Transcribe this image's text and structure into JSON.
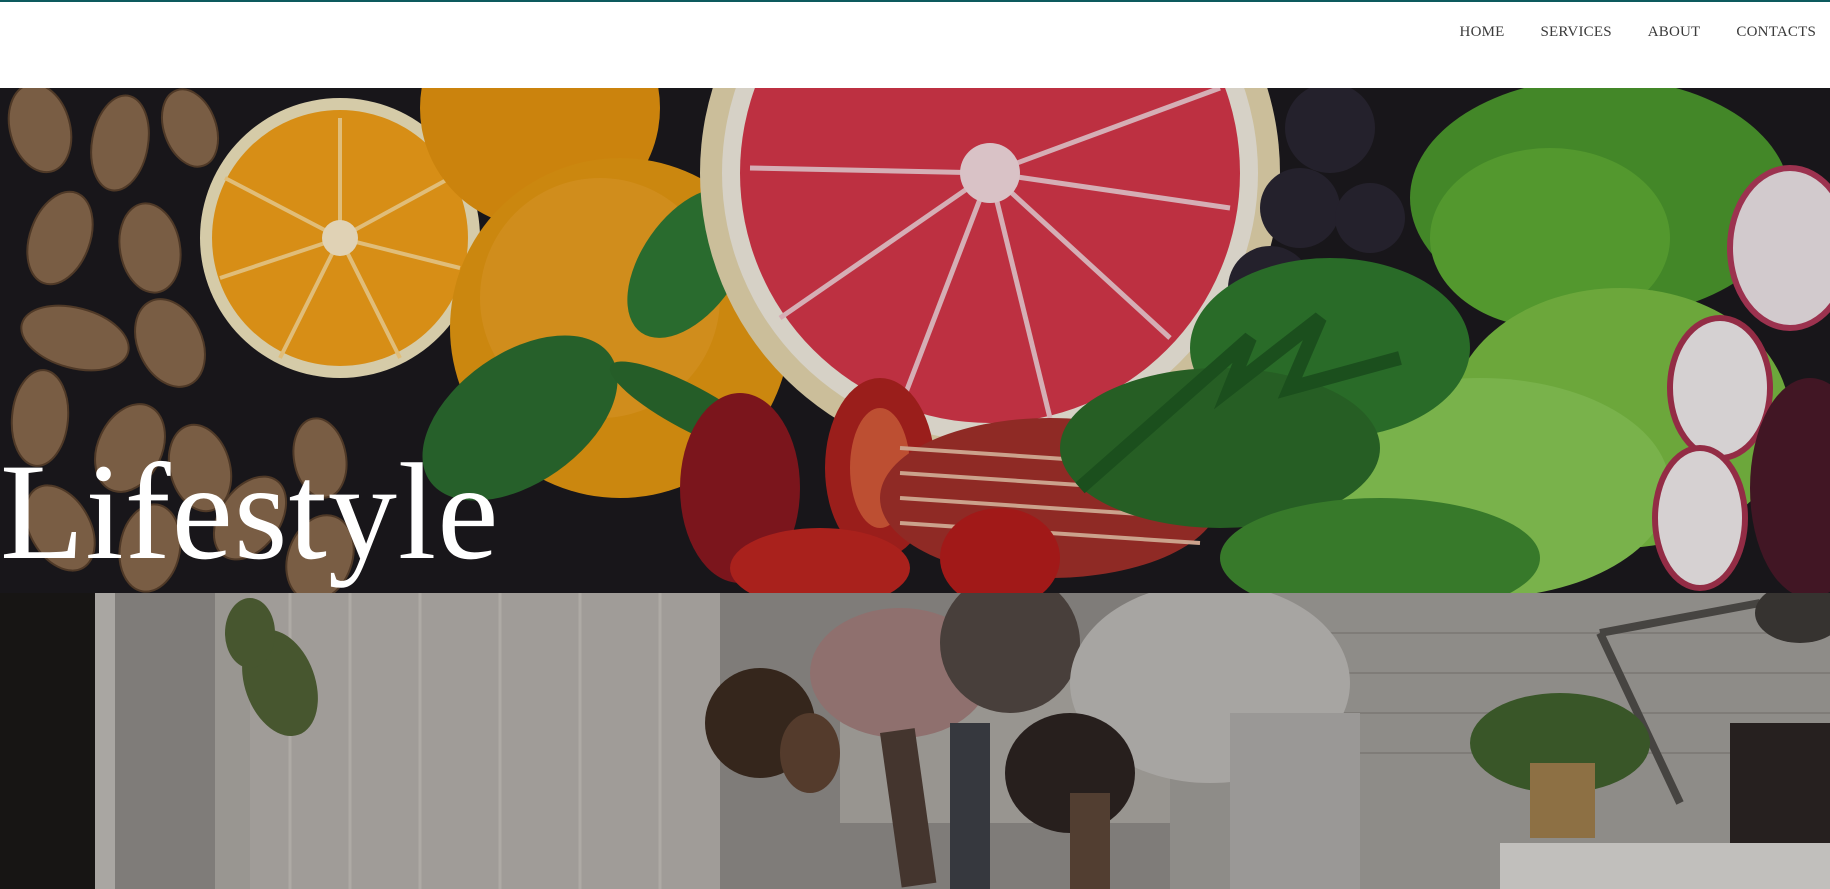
{
  "nav": {
    "items": [
      {
        "label": "HOME"
      },
      {
        "label": "SERVICES"
      },
      {
        "label": "ABOUT"
      },
      {
        "label": "CONTACTS"
      }
    ]
  },
  "hero": {
    "title": "Lifestyle"
  },
  "colors": {
    "accent_border": "#0d5a5e",
    "nav_text": "#3a3a3a",
    "title_text": "#ffffff"
  }
}
